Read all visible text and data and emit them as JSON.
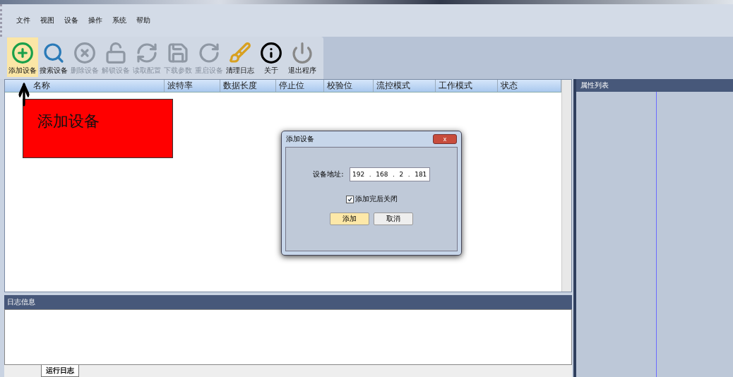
{
  "menu": [
    "文件",
    "视图",
    "设备",
    "操作",
    "系统",
    "帮助"
  ],
  "toolbar": [
    {
      "kind": "add",
      "label": "添加设备",
      "selected": true,
      "disabled": false
    },
    {
      "kind": "search",
      "label": "搜索设备",
      "selected": false,
      "disabled": false
    },
    {
      "kind": "delete",
      "label": "删除设备",
      "selected": false,
      "disabled": true
    },
    {
      "kind": "unlock",
      "label": "解锁设备",
      "selected": false,
      "disabled": true
    },
    {
      "kind": "read",
      "label": "读取配置",
      "selected": false,
      "disabled": true
    },
    {
      "kind": "save",
      "label": "下载参数",
      "selected": false,
      "disabled": true
    },
    {
      "kind": "restart",
      "label": "重启设备",
      "selected": false,
      "disabled": true
    },
    {
      "kind": "clear",
      "label": "清理日志",
      "selected": false,
      "disabled": false
    },
    {
      "kind": "about",
      "label": "关于",
      "selected": false,
      "disabled": false
    },
    {
      "kind": "exit",
      "label": "退出程序",
      "selected": false,
      "disabled": false
    }
  ],
  "table": {
    "columns": [
      "名称",
      "波特率",
      "数据长度",
      "停止位",
      "校验位",
      "流控模式",
      "工作模式",
      "状态"
    ]
  },
  "log_panel": {
    "title": "日志信息",
    "tabs": [
      {
        "label": "运行日志",
        "selected": true
      }
    ]
  },
  "property_panel": {
    "title": "属性列表"
  },
  "annotation": {
    "text": "添加设备"
  },
  "dialog": {
    "title": "添加设备",
    "close": "x",
    "address_label": "设备地址:",
    "ip": [
      "192",
      "168",
      "2",
      "181"
    ],
    "ip_separator": ".",
    "close_after_add": {
      "label": "添加完后关闭",
      "checked": true
    },
    "buttons": [
      {
        "label": "添加",
        "selected": true
      },
      {
        "label": "取消",
        "selected": false
      }
    ]
  }
}
